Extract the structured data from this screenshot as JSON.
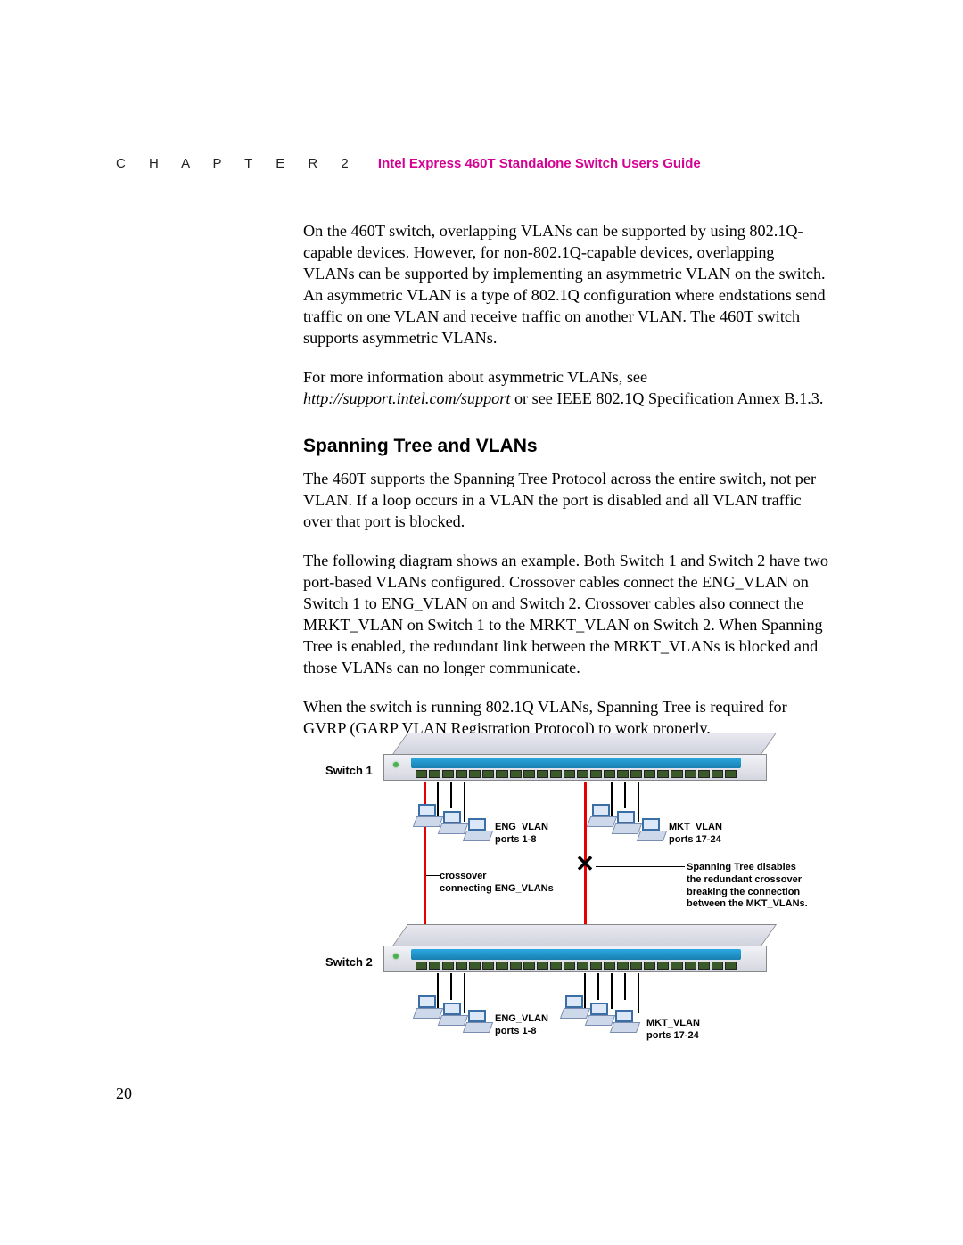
{
  "header": {
    "chapter": "C  H  A  P  T  E  R   2",
    "guide_title": "Intel Express 460T Standalone Switch Users Guide"
  },
  "body": {
    "p1": "On the 460T switch, overlapping VLANs can be supported by using 802.1Q-capable devices. However, for non-802.1Q-capable devices, overlapping VLANs can be supported by implementing an asymmetric VLAN on the switch. An asymmetric VLAN is a type of 802.1Q configuration where endstations send traffic on one VLAN and receive traffic on another VLAN. The 460T switch supports asymmetric VLANs.",
    "p2a": "For more information about asymmetric VLANs, see ",
    "p2_link": "http://support.intel.com/support",
    "p2b": " or see IEEE 802.1Q Specification Annex B.1.3.",
    "section_title": "Spanning Tree and VLANs",
    "p3": "The 460T supports the Spanning Tree Protocol across the entire switch, not per VLAN. If a loop occurs in a VLAN the port is disabled and all VLAN traffic over that port is blocked.",
    "p4": "The following diagram shows an example. Both Switch 1 and Switch 2 have two port-based VLANs configured. Crossover cables connect the ENG_VLAN on Switch 1 to ENG_VLAN on and Switch 2. Crossover cables also connect the MRKT_VLAN on Switch 1 to the MRKT_VLAN on Switch 2. When Spanning Tree is enabled, the redundant link between the MRKT_VLANs is blocked and those VLANs can no longer communicate.",
    "p5": "When the switch is running 802.1Q VLANs, Spanning Tree is required for GVRP (GARP VLAN Registration Protocol) to work properly."
  },
  "diagram": {
    "switch1_label": "Switch 1",
    "switch2_label": "Switch 2",
    "eng_vlan_label": "ENG_VLAN\nports 1-8",
    "mkt_vlan_label": "MKT_VLAN\nports 17-24",
    "crossover_label": "crossover\nconnecting ENG_VLANs",
    "stp_label": "Spanning Tree disables\nthe redundant crossover\nbreaking the connection\nbetween the MKT_VLANs."
  },
  "page_number": "20"
}
